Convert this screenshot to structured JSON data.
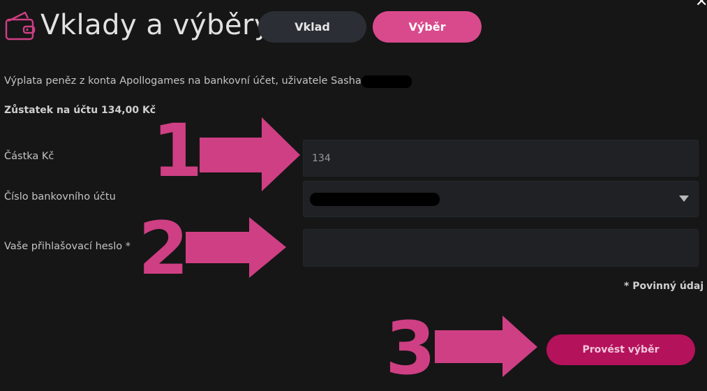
{
  "header": {
    "title": "Vklady a výběry",
    "tabs": [
      {
        "label": "Vklad",
        "active": false
      },
      {
        "label": "Výběr",
        "active": true
      }
    ]
  },
  "info": {
    "payout_text": "Výplata peněz z konta Apollogames na bankovní účet, uživatele Sasha",
    "balance_text": "Zůstatek na účtu 134,00 Kč"
  },
  "form": {
    "amount": {
      "label": "Částka Kč",
      "value": "134"
    },
    "account": {
      "label": "Číslo bankovního účtu"
    },
    "password": {
      "label": "Vaše přihlašovací heslo *",
      "value": ""
    },
    "required_note": "* Povinný údaj",
    "submit_label": "Provést výběr"
  },
  "annotations": {
    "step_1": "1",
    "step_2": "2",
    "step_3": "3"
  },
  "icons": {
    "header": "wallet-icon",
    "close": "close-icon",
    "select_caret": "caret-down-icon"
  },
  "colors": {
    "background": "#161616",
    "accent": "#d94a8c",
    "button": "#b5125c",
    "annotation": "#cf3f84",
    "field": "#1f2125",
    "tab_inactive": "#2b2e34"
  }
}
